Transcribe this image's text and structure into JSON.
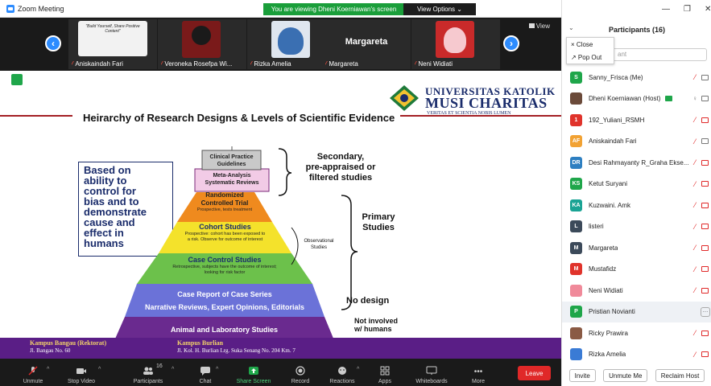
{
  "window": {
    "title": "Zoom Meeting"
  },
  "banner": {
    "viewing": "You are viewing Dheni Koerniawan's screen",
    "view_options": "View Options ⌄"
  },
  "strip": {
    "view_label": "View",
    "tiles": [
      {
        "name": "Aniskaindah Fari"
      },
      {
        "name": "Veroneka Rosefpa Wi..."
      },
      {
        "name": "Rizka Amelia"
      },
      {
        "name": "Margareta",
        "big": "Margareta"
      },
      {
        "name": "Neni Widiati"
      }
    ],
    "tile1_caption": "\"Build Yourself, Share Positive Content\""
  },
  "slide": {
    "uni_line1": "UNIVERSITAS KATOLIK",
    "uni_line2": "MUSI CHARITAS",
    "uni_line3": "VERITAS ET SCIENTIA NOBIS LUMEN",
    "title": "Heirarchy of Research Designs & Levels of Scientific Evidence",
    "left_box": [
      "Based on",
      "ability to",
      "control for",
      "bias and to",
      "demonstrate",
      "cause and",
      "effect in",
      "humans"
    ],
    "levels": {
      "clinical_1": "Clinical Practice",
      "clinical_2": "Guidelines",
      "meta_1": "Meta-Analysis",
      "meta_2": "Systematic Reviews",
      "rct_1": "Randomized",
      "rct_2": "Controlled Trial",
      "rct_3": "Prospective, tests treatment",
      "cohort_1": "Cohort Studies",
      "cohort_2": "Prospective: cohort has been exposed to",
      "cohort_3": "a risk. Observe for outcome of interest",
      "cc_1": "Case Control Studies",
      "cc_2": "Retrospective, subjects have the outcome of interest;",
      "cc_3": "looking for risk factor",
      "cr_1": "Case Report of Case Series",
      "cr_2": "Narrative Reviews, Expert Opinions, Editorials",
      "animal": "Animal and Laboratory Studies"
    },
    "right_labels": {
      "secondary_1": "Secondary,",
      "secondary_2": "pre-appraised or",
      "secondary_3": "filtered studies",
      "primary_1": "Primary",
      "primary_2": "Studies",
      "observational_1": "Observational",
      "observational_2": "Studies",
      "no_design": "No design",
      "not_involved_1": "Not involved",
      "not_involved_2": "w/ humans"
    },
    "footer": {
      "left_1": "Kampus Bangau (Rektorat)",
      "left_2": "Jl. Bangau No. 60",
      "right_1": "Kampus Burlian",
      "right_2": "Jl. Kol. H. Burlian Lrg. Suka Senang No. 204 Km. 7"
    }
  },
  "toolbar": {
    "unmute": "Unmute",
    "stop_video": "Stop Video",
    "participants": "Participants",
    "participants_count": "16",
    "chat": "Chat",
    "share": "Share Screen",
    "record": "Record",
    "reactions": "Reactions",
    "apps": "Apps",
    "whiteboards": "Whiteboards",
    "more": "More",
    "leave": "Leave"
  },
  "panel": {
    "title": "Participants (16)",
    "popmenu": {
      "close": "× Close",
      "popout": "↗ Pop Out"
    },
    "search_placeholder": "ant",
    "participants": [
      {
        "initials": "S",
        "name": "Sanny_Frisca (Me)",
        "color": "#1fa64a"
      },
      {
        "initials": "",
        "name": "Dheni Koerniawan (Host)",
        "color": "#6b4a3a"
      },
      {
        "initials": "1",
        "name": "192_Yuliani_RSMH",
        "color": "#e0332b"
      },
      {
        "initials": "AF",
        "name": "Aniskaindah Fari",
        "color": "#f2a233"
      },
      {
        "initials": "DR",
        "name": "Desi Rahmayanty R_Graha Ekse...",
        "color": "#2d7fc1"
      },
      {
        "initials": "KS",
        "name": "Ketut Suryani",
        "color": "#1fa64a"
      },
      {
        "initials": "KA",
        "name": "Kuzwaini. Amk",
        "color": "#1aa394"
      },
      {
        "initials": "L",
        "name": "listeri",
        "color": "#3c4a5a"
      },
      {
        "initials": "M",
        "name": "Margareta",
        "color": "#3c4a5a"
      },
      {
        "initials": "M",
        "name": "Mustafidz",
        "color": "#e0332b"
      },
      {
        "initials": "",
        "name": "Neni Widiati",
        "color": "#f08a9a"
      },
      {
        "initials": "P",
        "name": "Pristian Novianti",
        "color": "#1fa64a"
      },
      {
        "initials": "",
        "name": "Ricky Prawira",
        "color": "#8a5a44"
      },
      {
        "initials": "",
        "name": "Rizka Amelia",
        "color": "#3a7bd5"
      }
    ],
    "more_btn": "…",
    "invite": "Invite",
    "unmute_me": "Unmute Me",
    "reclaim_host": "Reclaim Host"
  }
}
